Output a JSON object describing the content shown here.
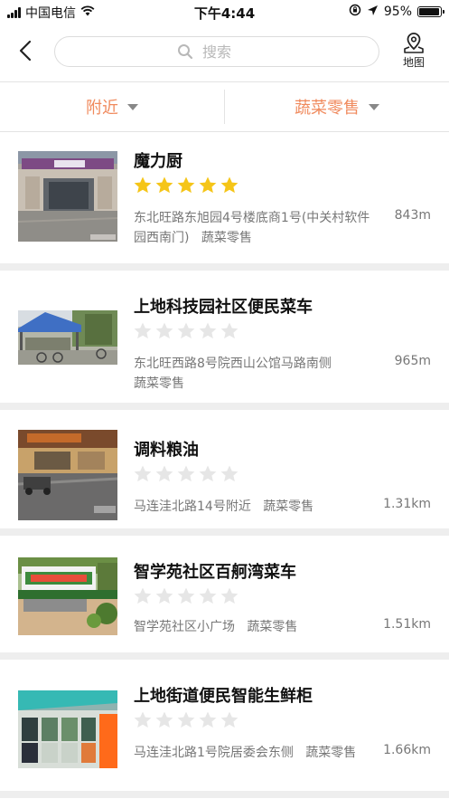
{
  "status": {
    "carrier": "中国电信",
    "time": "下午4:44",
    "battery": "95%",
    "battery_level": 0.95
  },
  "nav": {
    "search_placeholder": "搜索",
    "map_label": "地图"
  },
  "filters": [
    {
      "label": "附近"
    },
    {
      "label": "蔬菜零售"
    }
  ],
  "colors": {
    "accent": "#f08a5d",
    "star_on": "#f5c518",
    "star_off": "#e6e6e6"
  },
  "shops": [
    {
      "name": "魔力厨",
      "rating": 5,
      "address": "东北旺路东旭园4号楼底商1号(中关村软件园西南门)",
      "category": "蔬菜零售",
      "distance": "843m"
    },
    {
      "name": "上地科技园社区便民菜车",
      "rating": 0,
      "address": "东北旺西路8号院西山公馆马路南侧",
      "category": "蔬菜零售",
      "distance": "965m"
    },
    {
      "name": "调料粮油",
      "rating": 0,
      "address": "马连洼北路14号附近",
      "category": "蔬菜零售",
      "distance": "1.31km"
    },
    {
      "name": "智学苑社区百舸湾菜车",
      "rating": 0,
      "address": "智学苑社区小广场",
      "category": "蔬菜零售",
      "distance": "1.51km"
    },
    {
      "name": "上地街道便民智能生鲜柜",
      "rating": 0,
      "address": "马连洼北路1号院居委会东侧",
      "category": "蔬菜零售",
      "distance": "1.66km"
    }
  ]
}
